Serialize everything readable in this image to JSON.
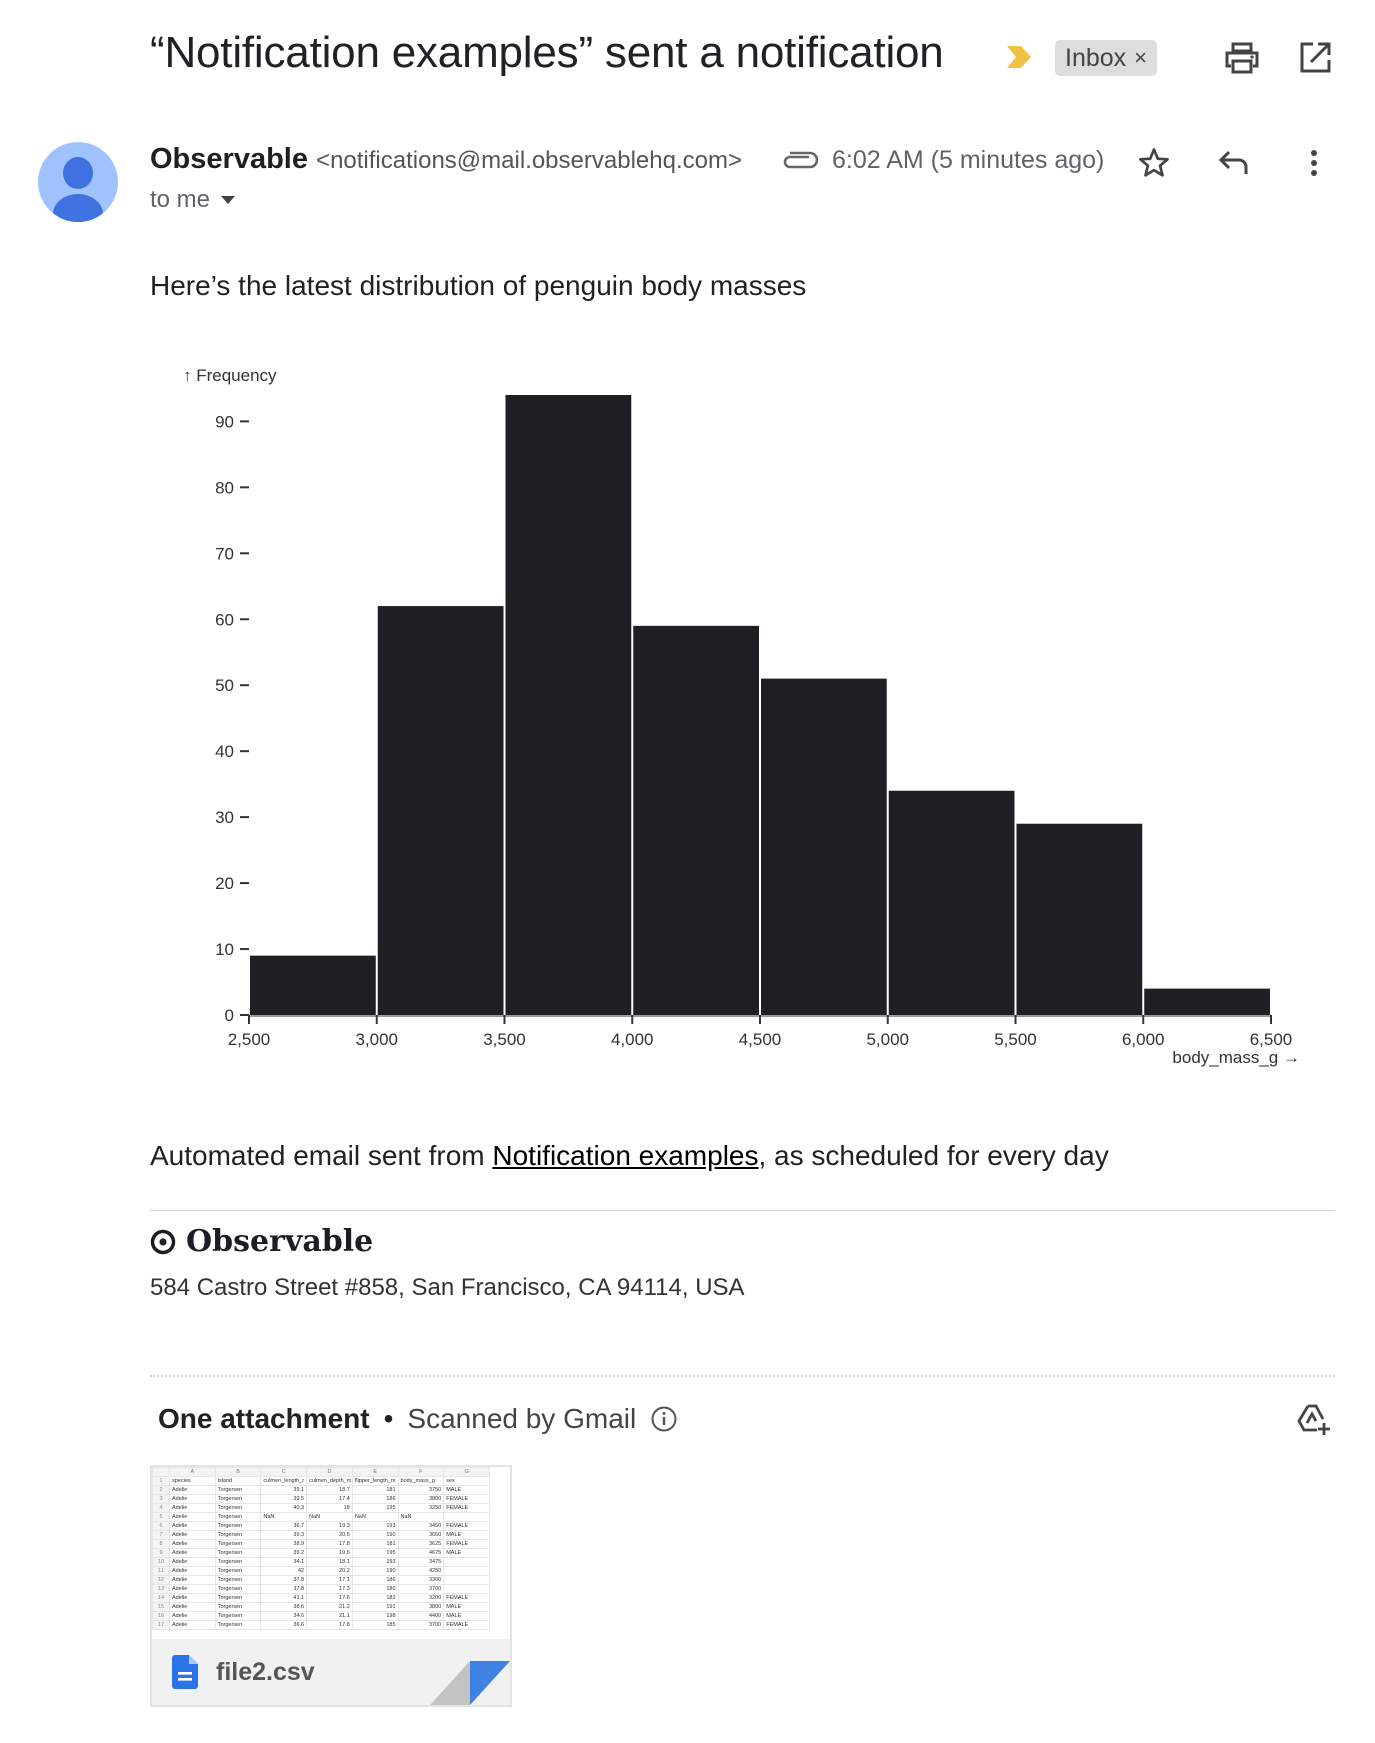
{
  "header": {
    "subject": "“Notification examples” sent a notification",
    "label": "Inbox",
    "label_remove": "×",
    "icons": {
      "importance": "importance-marker-icon",
      "print": "print-icon",
      "open_new_window": "open-in-new-window-icon"
    }
  },
  "message": {
    "sender_name": "Observable",
    "sender_email": "<notifications@mail.observablehq.com>",
    "recipient": "to me",
    "timestamp": "6:02 AM (5 minutes ago)",
    "icons": {
      "attachment": "paperclip-icon",
      "star": "star-icon",
      "reply": "reply-icon",
      "more": "more-vert-icon"
    },
    "intro": "Here’s the latest distribution of penguin body masses",
    "footer_prefix": "Automated email sent from ",
    "footer_link": "Notification examples",
    "footer_suffix": ", as scheduled for every day",
    "brand": "Observable",
    "address": "584 Castro Street #858, San Francisco, CA 94114, USA"
  },
  "chart_data": {
    "type": "bar",
    "title": "",
    "xlabel": "body_mass_g →",
    "ylabel": "↑ Frequency",
    "bins": [
      [
        2500,
        3000
      ],
      [
        3000,
        3500
      ],
      [
        3500,
        4000
      ],
      [
        4000,
        4500
      ],
      [
        4500,
        5000
      ],
      [
        5000,
        5500
      ],
      [
        5500,
        6000
      ],
      [
        6000,
        6500
      ]
    ],
    "values": [
      9,
      62,
      94,
      59,
      51,
      34,
      29,
      4
    ],
    "xlim": [
      2500,
      6500
    ],
    "ylim": [
      0,
      94
    ],
    "x_ticks": [
      "2,500",
      "3,000",
      "3,500",
      "4,000",
      "4,500",
      "5,000",
      "5,500",
      "6,000",
      "6,500"
    ],
    "x_tick_values": [
      2500,
      3000,
      3500,
      4000,
      4500,
      5000,
      5500,
      6000,
      6500
    ],
    "y_ticks": [
      0,
      10,
      20,
      30,
      40,
      50,
      60,
      70,
      80,
      90
    ],
    "grid": false,
    "bar_color": "#1f2024"
  },
  "attachments": {
    "title": "One attachment",
    "separator": "•",
    "scan_text": "Scanned by Gmail",
    "icons": {
      "info": "info-icon",
      "add_to_drive": "add-to-drive-icon"
    },
    "files": [
      {
        "name": "file2.csv",
        "icon": "google-docs-file-icon",
        "preview": {
          "col_letters": [
            "A",
            "B",
            "C",
            "D",
            "E",
            "F",
            "G"
          ],
          "rows": [
            [
              "species",
              "island",
              "culmen_length_r",
              "culmen_depth_m",
              "flipper_length_m",
              "body_mass_g",
              "sex"
            ],
            [
              "Adelie",
              "Torgersen",
              "39.1",
              "18.7",
              "181",
              "3750",
              "MALE"
            ],
            [
              "Adelie",
              "Torgersen",
              "39.5",
              "17.4",
              "186",
              "3800",
              "FEMALE"
            ],
            [
              "Adelie",
              "Torgersen",
              "40.3",
              "18",
              "195",
              "3250",
              "FEMALE"
            ],
            [
              "Adelie",
              "Torgersen",
              "NaN",
              "NaN",
              "NaN",
              "NaN",
              ""
            ],
            [
              "Adelie",
              "Torgersen",
              "36.7",
              "19.3",
              "193",
              "3450",
              "FEMALE"
            ],
            [
              "Adelie",
              "Torgersen",
              "39.3",
              "20.6",
              "190",
              "3650",
              "MALE"
            ],
            [
              "Adelie",
              "Torgersen",
              "38.9",
              "17.8",
              "181",
              "3625",
              "FEMALE"
            ],
            [
              "Adelie",
              "Torgersen",
              "39.2",
              "19.6",
              "195",
              "4675",
              "MALE"
            ],
            [
              "Adelie",
              "Torgersen",
              "34.1",
              "18.1",
              "193",
              "3475",
              ""
            ],
            [
              "Adelie",
              "Torgersen",
              "42",
              "20.2",
              "190",
              "4250",
              ""
            ],
            [
              "Adelie",
              "Torgersen",
              "37.8",
              "17.1",
              "186",
              "3300",
              ""
            ],
            [
              "Adelie",
              "Torgersen",
              "37.8",
              "17.3",
              "180",
              "3700",
              ""
            ],
            [
              "Adelie",
              "Torgersen",
              "41.1",
              "17.6",
              "182",
              "3200",
              "FEMALE"
            ],
            [
              "Adelie",
              "Torgersen",
              "38.6",
              "21.2",
              "191",
              "3800",
              "MALE"
            ],
            [
              "Adelie",
              "Torgersen",
              "34.6",
              "21.1",
              "198",
              "4400",
              "MALE"
            ],
            [
              "Adelie",
              "Torgersen",
              "36.6",
              "17.8",
              "185",
              "3700",
              "FEMALE"
            ]
          ]
        }
      }
    ]
  }
}
